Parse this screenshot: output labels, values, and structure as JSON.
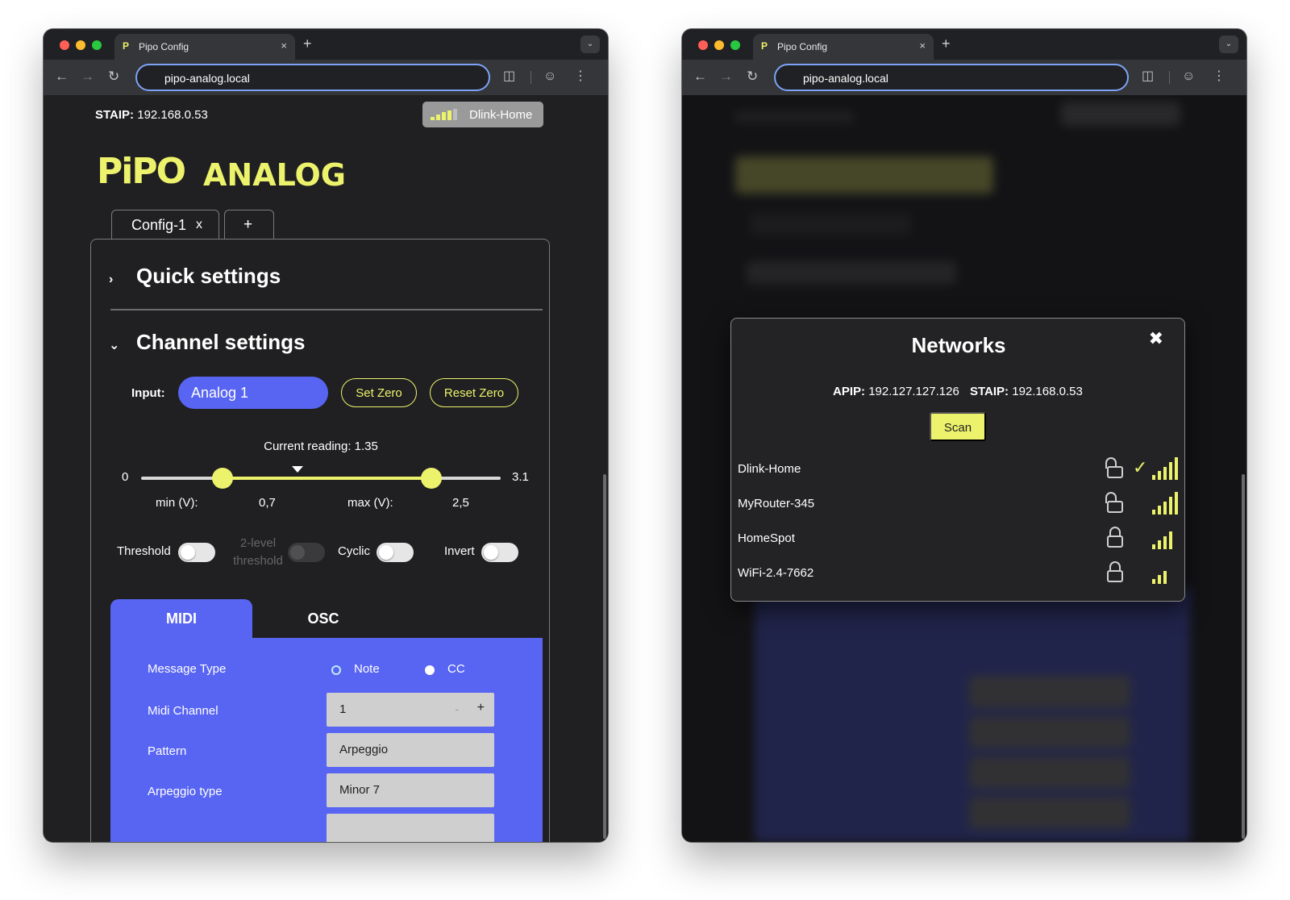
{
  "browser": {
    "tab_title": "Pipo Config",
    "tab_close": "×",
    "new_tab": "+",
    "url": "pipo-analog.local"
  },
  "status": {
    "staip_label": "STAIP:",
    "staip_value": "192.168.0.53",
    "network_name": "Dlink-Home"
  },
  "logo": {
    "pipo": "PiPO",
    "analog": "ANALOG"
  },
  "config_tabs": {
    "active_label": "Config-1",
    "active_close": "x",
    "add": "+"
  },
  "sections": {
    "quick": "Quick settings",
    "channel": "Channel settings"
  },
  "channel": {
    "input_label": "Input:",
    "input_value": "Analog 1",
    "set_zero": "Set Zero",
    "reset_zero": "Reset Zero",
    "current_reading_text": "Current reading: 1.35",
    "current_reading": 1.35,
    "range_min": 0,
    "range_max": 3.1,
    "range_min_text": "0",
    "range_max_text": "3.1",
    "min_label": "min (V):",
    "min_value": "0,7",
    "min_num": 0.7,
    "max_label": "max (V):",
    "max_value": "2,5",
    "max_num": 2.5
  },
  "toggles": {
    "threshold": "Threshold",
    "two_level_1": "2-level",
    "two_level_2": "threshold",
    "cyclic": "Cyclic",
    "invert": "Invert"
  },
  "protocol_tabs": {
    "midi": "MIDI",
    "osc": "OSC"
  },
  "midi": {
    "message_type_label": "Message Type",
    "opt_note": "Note",
    "opt_cc": "CC",
    "selected": "CC",
    "channel_label": "Midi Channel",
    "channel_value": "1",
    "stepper_minus": "-",
    "stepper_plus": "+",
    "pattern_label": "Pattern",
    "pattern_value": "Arpeggio",
    "arp_label": "Arpeggio type",
    "arp_value": "Minor 7"
  },
  "networks_modal": {
    "title": "Networks",
    "close": "✖",
    "apip_label": "APIP:",
    "apip_value": "192.127.127.126",
    "staip_label": "STAIP:",
    "staip_value": "192.168.0.53",
    "scan": "Scan",
    "list": [
      {
        "name": "Dlink-Home",
        "lock": "open",
        "connected": true,
        "signal": 5
      },
      {
        "name": "MyRouter-345",
        "lock": "open",
        "connected": false,
        "signal": 5
      },
      {
        "name": "HomeSpot",
        "lock": "closed",
        "connected": false,
        "signal": 4
      },
      {
        "name": "WiFi-2.4-7662",
        "lock": "closed",
        "connected": false,
        "signal": 3
      }
    ]
  },
  "colors": {
    "accent_yellow": "#ecf26b",
    "accent_blue": "#5865f2",
    "background": "#202022"
  }
}
